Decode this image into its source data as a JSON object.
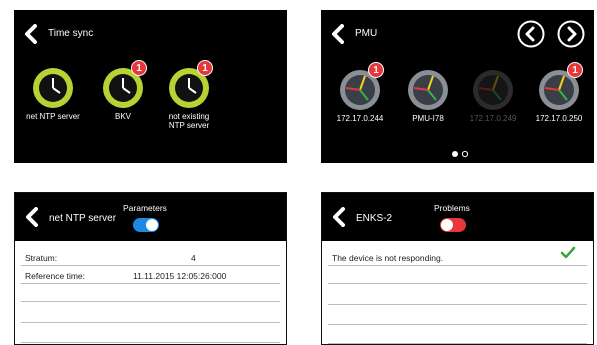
{
  "time_sync": {
    "title": "Time sync",
    "items": [
      {
        "label_line1": "net NTP server",
        "label_line2": "",
        "badge": ""
      },
      {
        "label_line1": "BKV",
        "label_line2": "",
        "badge": "1"
      },
      {
        "label_line1": "not existing",
        "label_line2": "NTP server",
        "badge": "1"
      }
    ]
  },
  "pmu": {
    "title": "PMU",
    "devices": [
      {
        "label": "172.17.0.244",
        "badge": "1",
        "active": true
      },
      {
        "label": "PMU-I78",
        "badge": "",
        "active": true
      },
      {
        "label": "172.17.0.249",
        "badge": "",
        "active": false
      },
      {
        "label": "172.17.0.250",
        "badge": "1",
        "active": true
      }
    ],
    "page_count": 2,
    "current_page": 1
  },
  "parameters": {
    "title": "net NTP server",
    "caption": "Parameters",
    "toggle_on": true,
    "rows": [
      {
        "key": "Stratum:",
        "value": "4"
      },
      {
        "key": "Reference time:",
        "value": "11.11.2015 12:05:26:000"
      },
      {
        "key": "",
        "value": ""
      },
      {
        "key": "",
        "value": ""
      },
      {
        "key": "",
        "value": ""
      }
    ]
  },
  "problems": {
    "title": "ENKS-2",
    "caption": "Problems",
    "toggle_on": false,
    "rows": [
      {
        "text": "The device is not responding.",
        "checked": true
      },
      {
        "text": "",
        "checked": false
      },
      {
        "text": "",
        "checked": false
      },
      {
        "text": "",
        "checked": false
      },
      {
        "text": "",
        "checked": false
      }
    ]
  },
  "colors": {
    "clock_ring": "#b5d334",
    "badge": "#e8363b",
    "toggle_on": "#1e88e5",
    "toggle_off": "#e8363b",
    "check": "#3aa63a"
  }
}
